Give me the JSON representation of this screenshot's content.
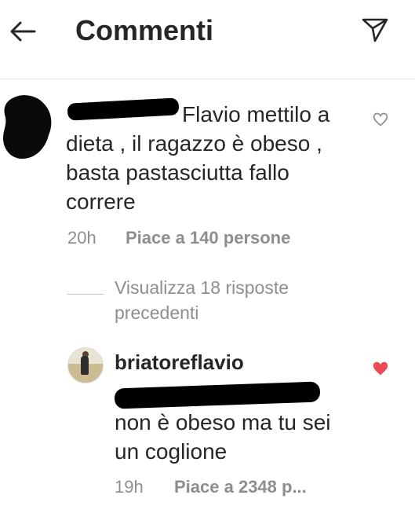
{
  "header": {
    "title": "Commenti"
  },
  "comment1": {
    "text": "Flavio mettilo a dieta , il ragazzo è obeso , basta pastasciutta fallo correre",
    "lines": [
      "Flavio mettilo a",
      "dieta , il ragazzo è obeso ,",
      "basta pastasciutta fallo",
      "correre"
    ],
    "time": "20h",
    "likes": "Piace a 140 persone"
  },
  "replies": {
    "view_previous": "Visualizza 18 risposte precedenti",
    "lines": [
      "Visualizza 18 risposte",
      "precedenti"
    ]
  },
  "reply1": {
    "username": "briatoreflavio",
    "lines": [
      "non è obeso ma tu sei",
      "un coglione"
    ],
    "time": "19h",
    "likes": "Piace a 2348 p..."
  },
  "colors": {
    "heart_liked": "#ed4956",
    "meta_grey": "#8e8e8e",
    "text": "#262626"
  }
}
